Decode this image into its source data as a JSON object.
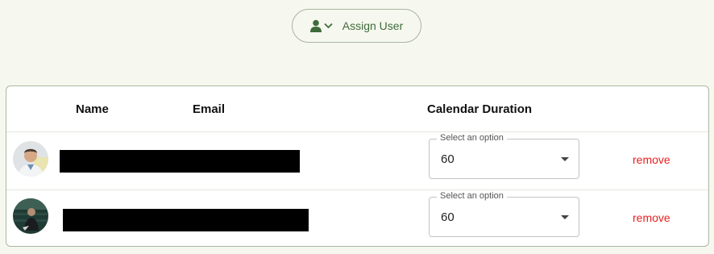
{
  "assign_button": {
    "label": "Assign User"
  },
  "table": {
    "headers": [
      "Name",
      "Email",
      "Calendar Duration"
    ],
    "rows": [
      {
        "duration_label": "Select an option",
        "duration_value": "60",
        "remove_label": "remove"
      },
      {
        "duration_label": "Select an option",
        "duration_value": "60",
        "remove_label": "remove"
      }
    ]
  },
  "colors": {
    "accent": "#3f6b3a",
    "remove": "#e82020",
    "background": "#f6f8ef"
  }
}
